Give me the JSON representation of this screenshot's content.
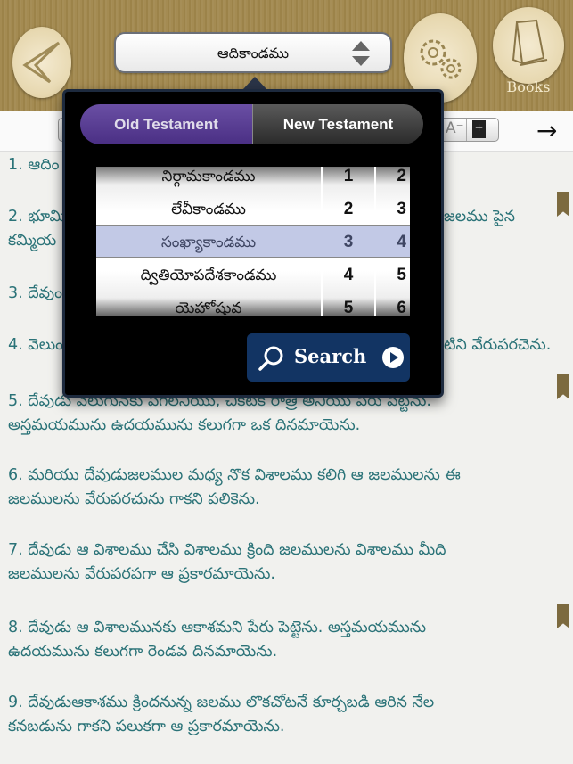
{
  "header": {
    "back_icon": "back-arrow-icon",
    "book_selector": {
      "value": "ఆదికాండము"
    },
    "settings_icon": "gears-icon",
    "books_label": "Books"
  },
  "toolbar": {
    "font_decrease": "A⁻",
    "bookmark_add": "+",
    "next_icon": "→"
  },
  "verses": [
    {
      "parts": [
        "1. ఆదిం",
        ""
      ]
    },
    {
      "parts": [
        "2. భూమి",
        "జలము పైన"
      ],
      "line2": "కమ్మియ"
    },
    {
      "parts": [
        "3. దేవుం",
        ""
      ]
    },
    {
      "parts": [
        "4. వెలుం",
        "టిని వేరుపరచెను."
      ]
    },
    {
      "line1": "5. దేవుడు వెలుగునకు పగలనియు, చీకటికి రాత్రి అనియు పేరు పెట్టెను.",
      "line2": "అస్తమయమును ఉదయమును కలుగగా ఒక దినమాయెను."
    },
    {
      "line1": "6. మరియు దేవుడుజలముల మధ్య నొక విశాలము కలిగి ఆ జలములను ఈ",
      "line2": "జలములను వేరుపరచును గాకని పలికెను."
    },
    {
      "line1": "7. దేవుడు ఆ విశాలము చేసి విశాలము క్రింది జలములను విశాలము మీది",
      "line2": "జలములను వేరుపరపగా ఆ ప్రకారమాయెను."
    },
    {
      "line1": "8. దేవుడు ఆ విశాలమునకు ఆకాశమని పేరు పెట్టెను. అస్తమయమును",
      "line2": "ఉదయమును కలుగగా రెండవ దినమాయెను."
    },
    {
      "line1": "9. దేవుడుఆకాశము క్రిందనున్న జలము లొకచోటనే కూర్చబడి ఆరిన నేల",
      "line2": "కనబడును గాకని పలుకగా ఆ ప్రకారమాయెను."
    }
  ],
  "popover": {
    "tabs": [
      {
        "label": "Old Testament",
        "selected": true
      },
      {
        "label": "New Testament",
        "selected": false
      }
    ],
    "books": [
      "నిర్గామకాండము",
      "లేవీకాండము",
      "సంఖ్యాకాండము",
      "ద్వితియోపదేశకాండము",
      "యెహోషువ"
    ],
    "chapters": [
      "1",
      "2",
      "3",
      "4",
      "5"
    ],
    "verses": [
      "2",
      "3",
      "4",
      "5",
      "6"
    ],
    "selected_index": 2,
    "search_label": "Search"
  },
  "colors": {
    "verse_text": "#2b7378",
    "selected_tab": "#5a3f94",
    "search_button": "#123463"
  }
}
